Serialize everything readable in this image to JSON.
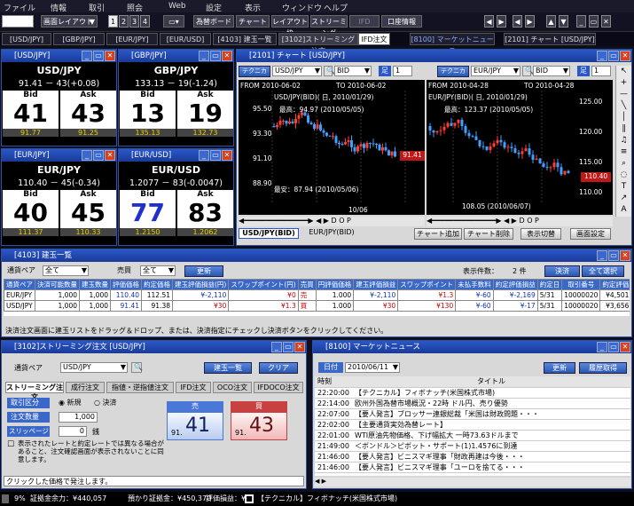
{
  "menu": {
    "items": [
      "ファイル",
      "情報",
      "取引",
      "照会",
      "Web",
      "設定",
      "表示",
      "ウィンドウ",
      "ヘルプ"
    ]
  },
  "toolbar": {
    "layout": "画面レイアウト",
    "nums": [
      "1",
      "2",
      "3",
      "4"
    ],
    "buttons": [
      "為替ボード",
      "チャート",
      "レイアウト枠",
      "ストリーミング",
      "IFD",
      "口座情報"
    ]
  },
  "tabs": [
    "[USD/JPY]",
    "[GBP/JPY]",
    "[EUR/JPY]",
    "[EUR/USD]",
    "[4103] 建玉一覧",
    "[3102]ストリーミング注文",
    "IFD注文",
    "[8100] マーケットニュース",
    "[2101] チャート [USD/JPY]"
  ],
  "rates": [
    {
      "title": "[USD/JPY]",
      "pair": "USD/JPY",
      "quote": "91.41 － 43(+0.08)",
      "bid_label": "Bid",
      "ask_label": "Ask",
      "bid": "41",
      "ask": "43",
      "bid_small": "91.77",
      "ask_small": "91.25"
    },
    {
      "title": "[GBP/JPY]",
      "pair": "GBP/JPY",
      "quote": "133.13 － 19(-1.24)",
      "bid_label": "Bid",
      "ask_label": "Ask",
      "bid": "13",
      "ask": "19",
      "bid_small": "135.13",
      "ask_small": "132.73"
    },
    {
      "title": "[EUR/JPY]",
      "pair": "EUR/JPY",
      "quote": "110.40 － 45(-0.34)",
      "bid_label": "Bid",
      "ask_label": "Ask",
      "bid": "40",
      "ask": "45",
      "bid_small": "111.37",
      "ask_small": "110.33"
    },
    {
      "title": "[EUR/USD]",
      "pair": "EUR/USD",
      "quote": "1.2077 － 83(-0.0047)",
      "bid_label": "Bid",
      "ask_label": "Ask",
      "bid": "77",
      "ask": "83",
      "bid_small": "1.2150",
      "ask_small": "1.2062"
    }
  ],
  "chart": {
    "title": "[2101] チャート [USD/JPY]",
    "tech": "テクニカル",
    "left": {
      "pair": "USD/JPY",
      "side": "BID",
      "foot": "足",
      "from": "FROM 2010-06-02",
      "to": "TO  2010-06-02",
      "info": "USD/JPY(BID)( 日, 2010/01/29)",
      "high": "最高：94.97 (2010/05/05)",
      "low": "最安：87.94 (2010/05/06)",
      "ticks": [
        "95.50",
        "93.30",
        "91.10",
        "88.90"
      ],
      "price": "91.41",
      "date": "10/06"
    },
    "right": {
      "pair": "EUR/JPY",
      "side": "BID",
      "foot": "足",
      "from": "FROM 2010-04-28",
      "to": "TO  2010-04-28",
      "info": "EUR/JPY(BID)( 日, 2010/01/29)",
      "high": "最高：123.37 (2010/05/05)",
      "low": "108.05 (2010/06/07)",
      "ticks": [
        "125.00",
        "120.00",
        "115.00",
        "110.00"
      ],
      "price": "110.40",
      "date": "10/06"
    },
    "tab1": "USD/JPY(BID)",
    "tab2": "EUR/JPY(BID)",
    "btns": [
      "チャート追加",
      "チャート削除",
      "表示切替",
      "画面設定"
    ]
  },
  "positions": {
    "title": "[4103] 建玉一覧",
    "pair_label": "通貨ペア",
    "pair_val": "全て",
    "side_label": "売買",
    "side_val": "全て",
    "refresh": "更新",
    "count_label": "表示件数：",
    "count": "2 件",
    "settle": "決済",
    "select_all": "全て選択",
    "headers": [
      "通貨ペア",
      "決済可能数量",
      "建玉数量",
      "評価価格",
      "約定価格",
      "建玉評価損益(円)",
      "スワップポイント(円)",
      "売買",
      "円評価価格",
      "建玉評価損益",
      "スワップポイント",
      "未払手数料",
      "約定評価損益",
      "約定日",
      "取引番号",
      "約定評価",
      "決済"
    ],
    "rows": [
      [
        "EUR/JPY",
        "1,000",
        "1,000",
        "110.40",
        "112.51",
        "¥-2,110",
        "¥0",
        "売",
        "1.000",
        "¥-2,110",
        "¥1.3",
        "¥-60",
        "¥-2,169",
        "5/31",
        "10000020",
        "¥4,501",
        ""
      ],
      [
        "USD/JPY",
        "1,000",
        "1,000",
        "91.41",
        "91.38",
        "¥30",
        "¥1.3",
        "買",
        "1.000",
        "¥30",
        "¥130",
        "¥-60",
        "¥-17",
        "5/31",
        "10000020",
        "¥3,656",
        ""
      ]
    ],
    "hint": "決済注文画面に建玉リストをドラッグ＆ドロップ、または、決済指定にチェックし決済ボタンをクリックしてください。"
  },
  "streaming": {
    "title": "[3102]ストリーミング注文 [USD/JPY]",
    "pair_label": "通貨ペア",
    "pair": "USD/JPY",
    "list_btn": "建玉一覧",
    "clear_btn": "クリア",
    "tabs": [
      "ストリーミング注文",
      "成行注文",
      "指値・逆指値注文",
      "IFD注文",
      "OCO注文",
      "IFDOCO注文"
    ],
    "kubun": "取引区分",
    "new": "新規",
    "settle": "決済",
    "qty_label": "注文数量",
    "qty": "1,000",
    "slip_label": "スリッページ",
    "slip": "0",
    "slip_unit": "銭",
    "sell": "売",
    "buy": "買",
    "sell_pre": "91.",
    "sell_big": "41",
    "buy_pre": "91.",
    "buy_big": "43",
    "note": "表示されたレートと約定レートでは異なる場合があること、注文確認画面が表示されないことに同意します。",
    "status": "クリックした価格で発注します。"
  },
  "news": {
    "title": "[8100] マーケットニュース",
    "date_label": "日付",
    "date": "2010/06/11",
    "refresh": "更新",
    "history": "履歴取得",
    "col_time": "時刻",
    "col_title": "タイトル",
    "rows": [
      [
        "22:20:00",
        "【テクニカル】フィボナッチ(米国株式市場)"
      ],
      [
        "22:14:00",
        "欧州外国為替市場概況・22時 ドル円、売り優勢"
      ],
      [
        "22:07:00",
        "【要人発言】ブロッサー連銀総裁「米国は財政問題・・・"
      ],
      [
        "22:02:00",
        "【主要通貨実効為替レート】"
      ],
      [
        "22:01:00",
        "WTI原油先物価格、下げ幅拡大 一時73.63ドルまで"
      ],
      [
        "21:49:00",
        "＜ボンドル＞ピボット・サポート(1)1.4576に到達"
      ],
      [
        "21:46:00",
        "【要人発言】ビニスマギ理事「財政再建は今後・・・"
      ],
      [
        "21:46:00",
        "【要人発言】ビニスマギ理事「ユーロを捨てる・・・"
      ]
    ]
  },
  "statusbar": {
    "pct": "9%",
    "margin": "証拠金余力：¥440,057",
    "deposit": "預かり証拠金：¥450,370",
    "pl": "評価損益：¥",
    "ticker": "【テクニカル】フィボナッチ(米国株式市場)"
  }
}
